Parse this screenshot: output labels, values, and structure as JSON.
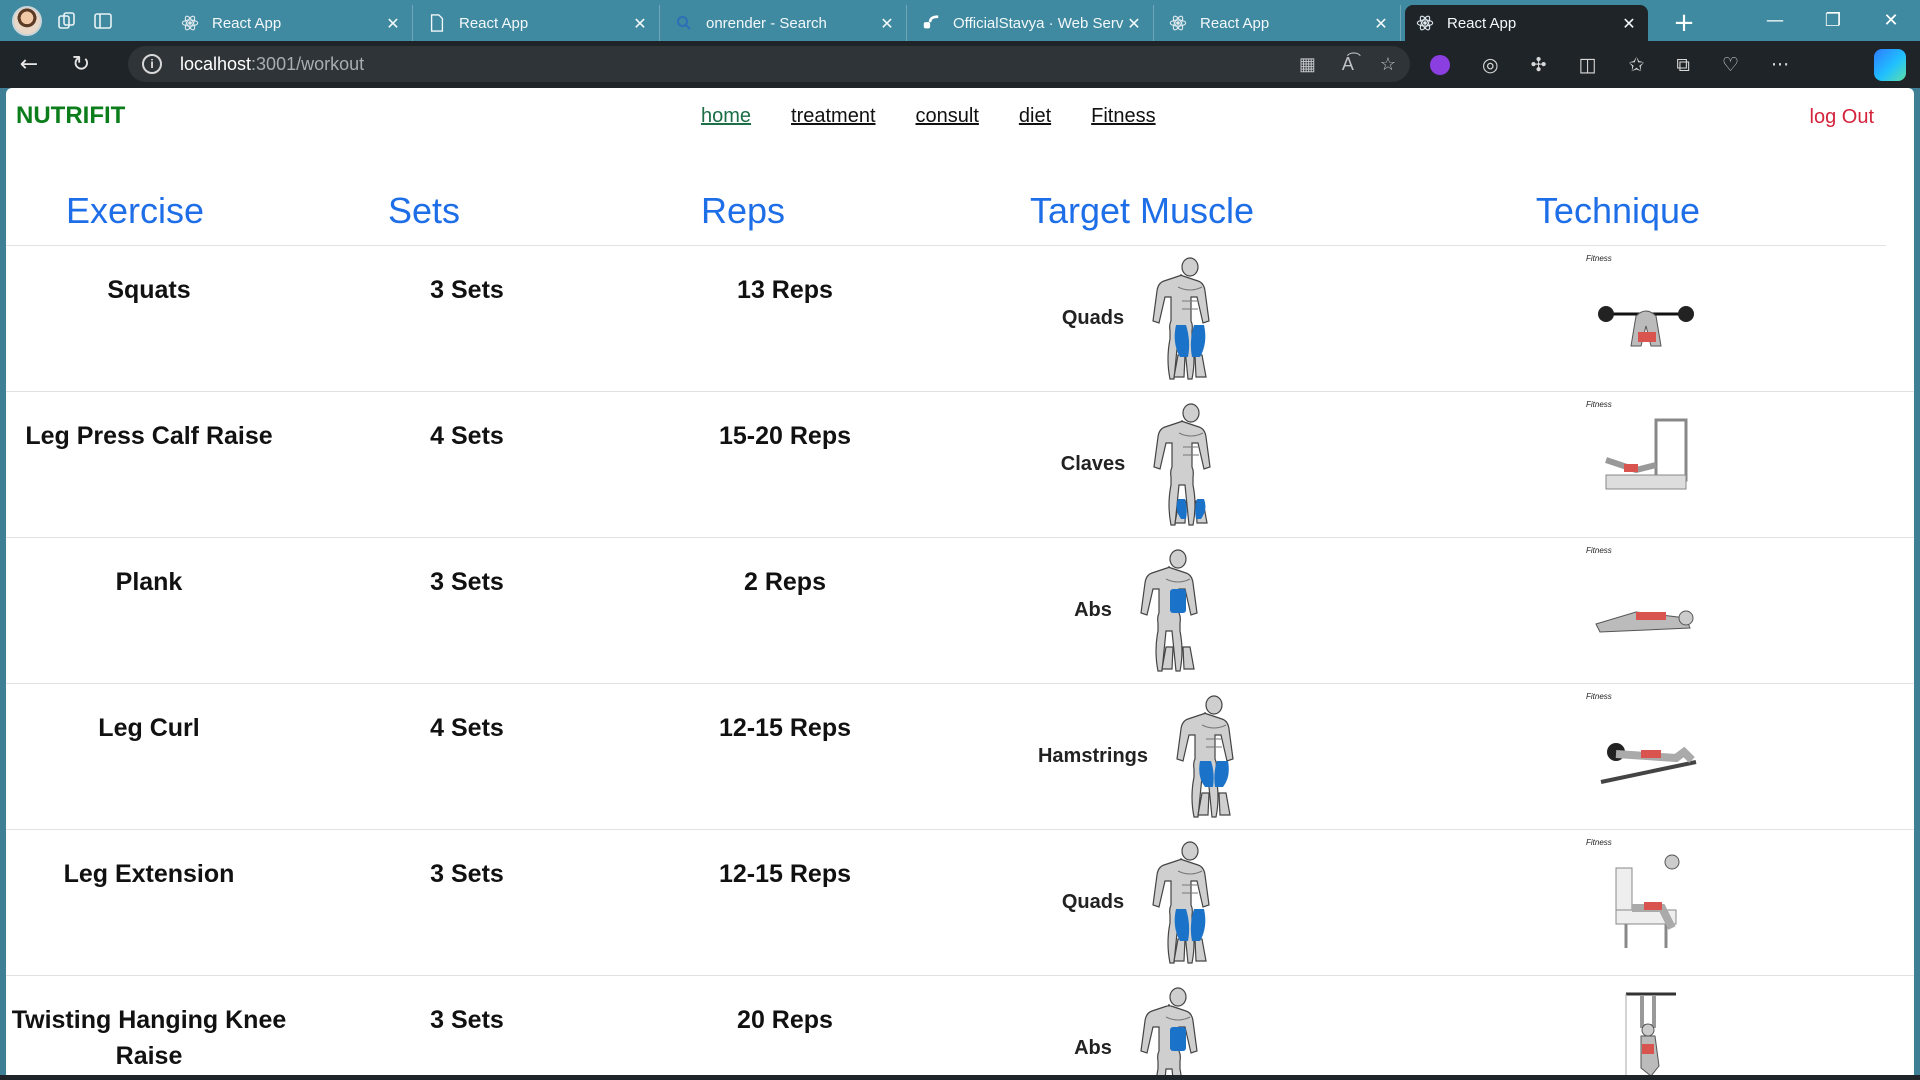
{
  "browser": {
    "tabs": [
      {
        "title": "React App",
        "icon": "react-icon"
      },
      {
        "title": "React App",
        "icon": "page-icon"
      },
      {
        "title": "onrender - Search",
        "icon": "search-icon"
      },
      {
        "title": "OfficialStavya · Web Serv",
        "icon": "render-icon"
      },
      {
        "title": "React App",
        "icon": "react-icon"
      },
      {
        "title": "React App",
        "icon": "react-icon",
        "active": true
      }
    ],
    "url_host": "localhost",
    "url_path": ":3001/workout"
  },
  "app": {
    "brand": "NUTRIFIT",
    "nav": [
      "home",
      "treatment",
      "consult",
      "diet",
      "Fitness"
    ],
    "logout": "log Out"
  },
  "table": {
    "headers": [
      "Exercise",
      "Sets",
      "Reps",
      "Target Muscle",
      "Technique"
    ],
    "rows": [
      {
        "exercise": "Squats",
        "sets": "3 Sets",
        "reps": "13 Reps",
        "muscle": "Quads",
        "view": "front",
        "highlight": "quads",
        "tech_logo": "Fitness"
      },
      {
        "exercise": "Leg Press Calf Raise",
        "sets": "4 Sets",
        "reps": "15-20 Reps",
        "muscle": "Claves",
        "view": "back",
        "highlight": "calves",
        "tech_logo": "Fitness"
      },
      {
        "exercise": "Plank",
        "sets": "3 Sets",
        "reps": "2 Reps",
        "muscle": "Abs",
        "view": "front",
        "highlight": "abs",
        "tech_logo": "Fitness"
      },
      {
        "exercise": "Leg Curl",
        "sets": "4 Sets",
        "reps": "12-15 Reps",
        "muscle": "Hamstrings",
        "view": "back",
        "highlight": "hamstrings",
        "tech_logo": "Fitness"
      },
      {
        "exercise": "Leg Extension",
        "sets": "3 Sets",
        "reps": "12-15 Reps",
        "muscle": "Quads",
        "view": "front",
        "highlight": "quads",
        "tech_logo": "Fitness"
      },
      {
        "exercise": "Twisting Hanging Knee Raise",
        "sets": "3 Sets",
        "reps": "20 Reps",
        "muscle": "Abs",
        "view": "front",
        "highlight": "abs",
        "tech_logo": ""
      }
    ]
  },
  "colors": {
    "brand": "#0b7d1a",
    "header": "#1e6ee8",
    "logout": "#d4233b",
    "muscle_highlight": "#1a73c9"
  }
}
